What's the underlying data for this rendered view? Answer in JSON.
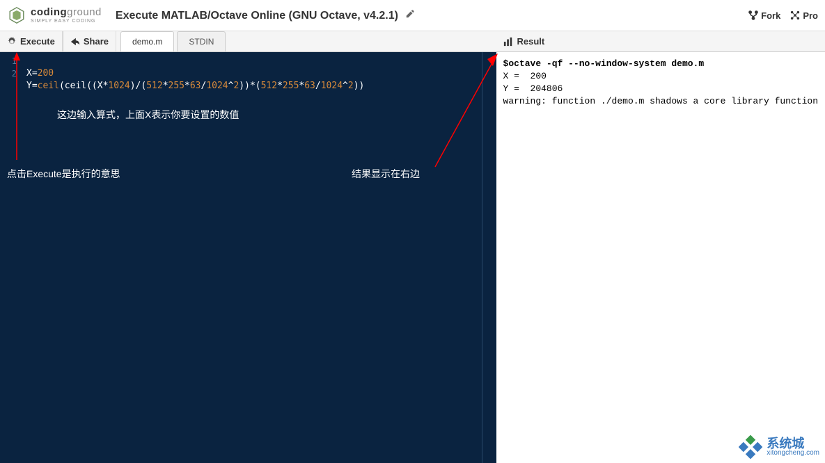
{
  "header": {
    "logo_main_a": "coding",
    "logo_main_b": "ground",
    "logo_sub": "SIMPLY EASY CODING",
    "title": "Execute MATLAB/Octave Online (GNU Octave, v4.2.1)",
    "fork": "Fork",
    "pro": "Pro"
  },
  "toolbar": {
    "execute": "Execute",
    "share": "Share",
    "tabs": [
      "demo.m",
      "STDIN"
    ]
  },
  "editor": {
    "gutter": [
      "1",
      "2"
    ],
    "line1_var": "X",
    "line1_eq": "=",
    "line1_val": "200",
    "line2_var": "Y",
    "line2_eq": "=",
    "line2_fn": "ceil",
    "line2_expr_a": "(ceil((X*",
    "line2_n1": "1024",
    "line2_expr_b": ")/(",
    "line2_n2": "512",
    "line2_star1": "*",
    "line2_n3": "255",
    "line2_star2": "*",
    "line2_n4": "63",
    "line2_slash": "/",
    "line2_n5": "1024",
    "line2_pow": "^",
    "line2_n6": "2",
    "line2_expr_c": "))*(",
    "line2_n7": "512",
    "line2_star3": "*",
    "line2_n8": "255",
    "line2_star4": "*",
    "line2_n9": "63",
    "line2_slash2": "/",
    "line2_n10": "1024",
    "line2_pow2": "^",
    "line2_n11": "2",
    "line2_expr_d": "))"
  },
  "result": {
    "title": "Result",
    "cmd": "$octave -qf --no-window-system demo.m",
    "line_x": "X =  200",
    "line_y": "Y =  204806",
    "warning": "warning: function ./demo.m shadows a core library function"
  },
  "annotations": {
    "input_hint": "这边输入算式，上面X表示你要设置的数值",
    "execute_hint": "点击Execute是执行的意思",
    "result_hint": "结果显示在右边"
  },
  "watermark": {
    "main": "系统城",
    "sub": "xitongcheng.com"
  }
}
